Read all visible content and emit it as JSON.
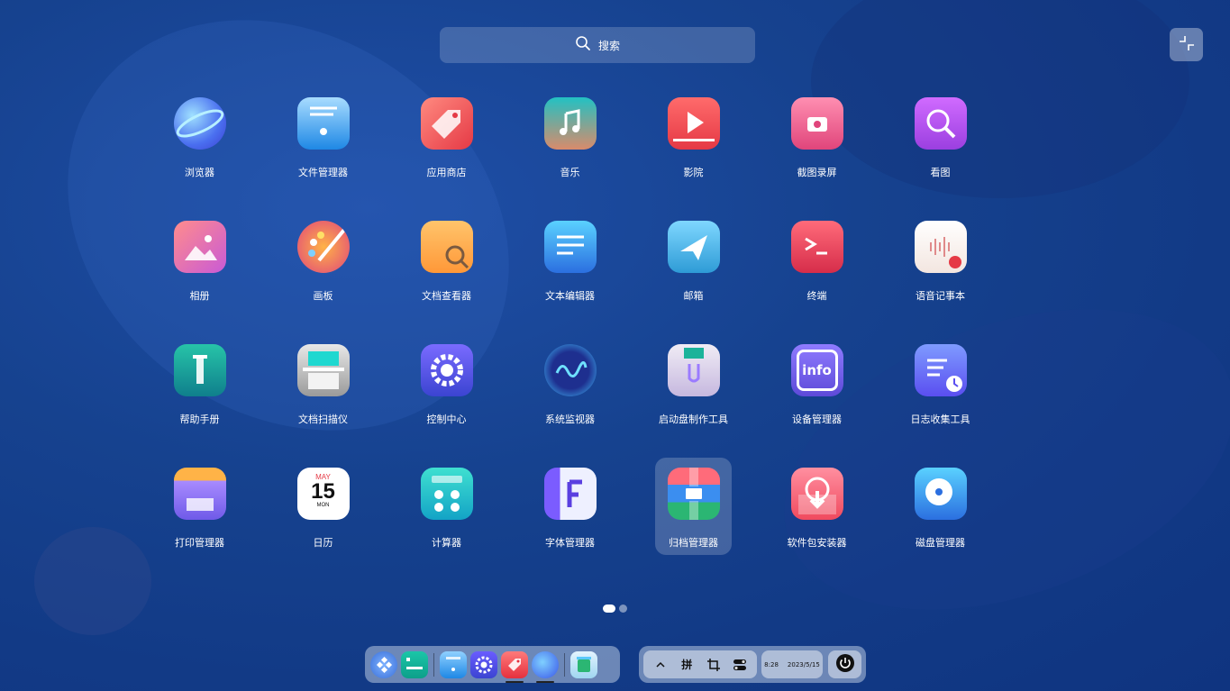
{
  "search": {
    "label": "搜索"
  },
  "apps": [
    {
      "label": "浏览器",
      "icon": "browser-icon"
    },
    {
      "label": "文件管理器",
      "icon": "file-manager-icon"
    },
    {
      "label": "应用商店",
      "icon": "app-store-icon"
    },
    {
      "label": "音乐",
      "icon": "music-icon"
    },
    {
      "label": "影院",
      "icon": "movie-icon"
    },
    {
      "label": "截图录屏",
      "icon": "screenshot-icon"
    },
    {
      "label": "看图",
      "icon": "image-viewer-icon"
    },
    {
      "label": "相册",
      "icon": "album-icon"
    },
    {
      "label": "画板",
      "icon": "draw-icon"
    },
    {
      "label": "文档查看器",
      "icon": "document-viewer-icon"
    },
    {
      "label": "文本编辑器",
      "icon": "text-editor-icon"
    },
    {
      "label": "邮箱",
      "icon": "mail-icon"
    },
    {
      "label": "终端",
      "icon": "terminal-icon"
    },
    {
      "label": "语音记事本",
      "icon": "voice-note-icon"
    },
    {
      "label": "帮助手册",
      "icon": "help-manual-icon"
    },
    {
      "label": "文档扫描仪",
      "icon": "scanner-icon"
    },
    {
      "label": "控制中心",
      "icon": "control-center-icon"
    },
    {
      "label": "系统监视器",
      "icon": "system-monitor-icon"
    },
    {
      "label": "启动盘制作工具",
      "icon": "boot-maker-icon"
    },
    {
      "label": "设备管理器",
      "icon": "device-manager-icon"
    },
    {
      "label": "日志收集工具",
      "icon": "log-viewer-icon"
    },
    {
      "label": "打印管理器",
      "icon": "print-manager-icon"
    },
    {
      "label": "日历",
      "icon": "calendar-icon"
    },
    {
      "label": "计算器",
      "icon": "calculator-icon"
    },
    {
      "label": "字体管理器",
      "icon": "font-manager-icon"
    },
    {
      "label": "归档管理器",
      "icon": "archive-manager-icon"
    },
    {
      "label": "软件包安装器",
      "icon": "package-installer-icon"
    },
    {
      "label": "磁盘管理器",
      "icon": "disk-manager-icon"
    }
  ],
  "selected_app": "归档管理器",
  "calendar_icon": {
    "month": "MAY",
    "day": "15",
    "weekday": "MON"
  },
  "device_icon_text": "info",
  "pages": {
    "current": 1,
    "total": 2
  },
  "dock": {
    "items": [
      "launcher-icon",
      "multitask-view-icon",
      "file-manager-icon",
      "control-center-icon",
      "app-store-icon",
      "browser-icon",
      "trash-icon"
    ]
  },
  "tray": {
    "input_method": "拼",
    "time": "8:28",
    "date": "2023/5/15"
  }
}
